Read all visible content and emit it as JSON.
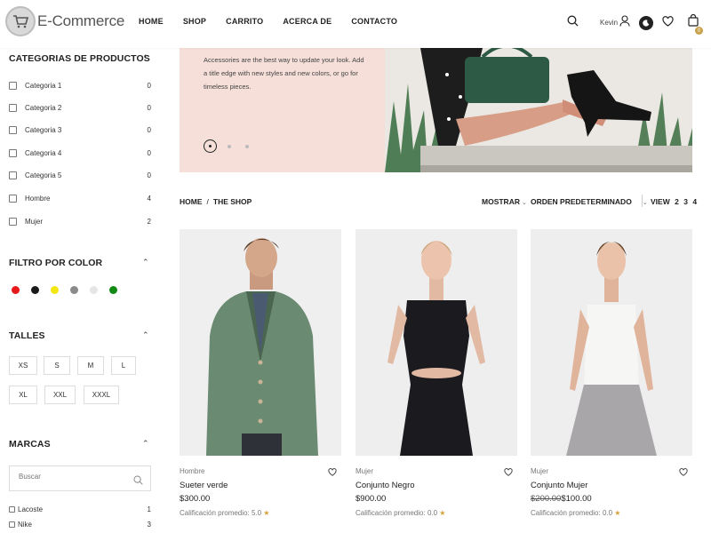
{
  "header": {
    "logo_text": "E-Commerce",
    "nav": [
      "HOME",
      "SHOP",
      "CARRITO",
      "ACERCA DE",
      "CONTACTO"
    ],
    "user_name": "Kevin",
    "cart_count": "0"
  },
  "sidebar": {
    "categories_title": "CATEGORIAS DE PRODUCTOS",
    "categories": [
      {
        "label": "Categoria 1",
        "count": "0"
      },
      {
        "label": "Categoria 2",
        "count": "0"
      },
      {
        "label": "Categoria 3",
        "count": "0"
      },
      {
        "label": "Categoria 4",
        "count": "0"
      },
      {
        "label": "Categoria 5",
        "count": "0"
      },
      {
        "label": "Hombre",
        "count": "4"
      },
      {
        "label": "Mujer",
        "count": "2"
      }
    ],
    "color_title": "FILTRO POR COLOR",
    "colors": [
      "#e8191a",
      "#1a1a1a",
      "#f2e613",
      "#8a8a8a",
      "#e6e6e6",
      "#138a13"
    ],
    "sizes_title": "TALLES",
    "sizes": [
      "XS",
      "S",
      "M",
      "L",
      "XL",
      "XXL",
      "XXXL"
    ],
    "brands_title": "MARCAS",
    "brand_search_placeholder": "Buscar",
    "brands": [
      {
        "label": "Lacoste",
        "count": "1"
      },
      {
        "label": "Nike",
        "count": "3"
      }
    ]
  },
  "banner": {
    "text": "Accessories are the best way to update your look. Add a title edge with new styles and new colors, or go for timeless pieces."
  },
  "toolbar": {
    "breadcrumb_home": "HOME",
    "breadcrumb_sep": "/",
    "breadcrumb_current": "THE SHOP",
    "show_label": "MOSTRAR",
    "sort_label": "ORDEN PREDETERMINADO",
    "view_label": "VIEW",
    "view_options": [
      "2",
      "3",
      "4"
    ]
  },
  "products": [
    {
      "category": "Hombre",
      "name": "Sueter verde",
      "old_price": "",
      "price": "$300.00",
      "rating_label": "Calificación promedio:",
      "rating": "5.0"
    },
    {
      "category": "Mujer",
      "name": "Conjunto Negro",
      "old_price": "",
      "price": "$900.00",
      "rating_label": "Calificación promedio:",
      "rating": "0.0"
    },
    {
      "category": "Mujer",
      "name": "Conjunto Mujer",
      "old_price": "$200.00",
      "price": "$100.00",
      "rating_label": "Calificación promedio:",
      "rating": "0.0"
    }
  ],
  "colors": {
    "accent": "#c9a14a",
    "banner_bg": "#f5dfd8",
    "star": "#d4a23a"
  }
}
